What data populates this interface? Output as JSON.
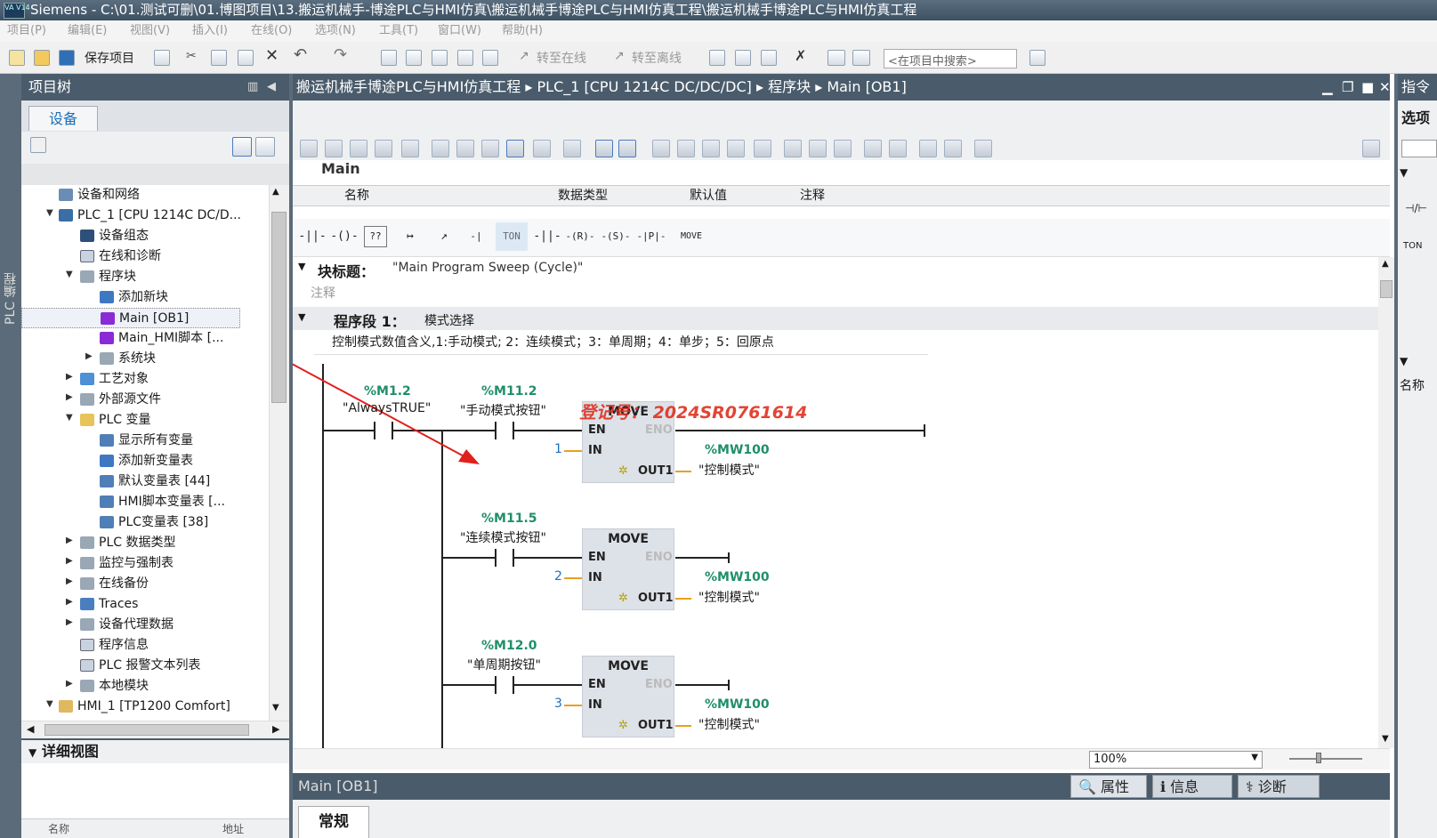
{
  "window": {
    "title": "Siemens  -  C:\\01.测试可删\\01.博图项目\\13.搬运机械手-博途PLC与HMI仿真\\搬运机械手博途PLC与HMI仿真工程\\搬运机械手博途PLC与HMI仿真工程",
    "logo_text": "VA V14"
  },
  "menu": [
    "项目(P)",
    "编辑(E)",
    "视图(V)",
    "插入(I)",
    "在线(O)",
    "选项(N)",
    "工具(T)",
    "窗口(W)",
    "帮助(H)"
  ],
  "toolbar": {
    "save_label": "保存项目",
    "go_online": "转至在线",
    "go_offline": "转至离线",
    "search_placeholder": "<在项目中搜索>"
  },
  "left_strip": {
    "label": "PLC 编程"
  },
  "project_tree": {
    "title": "项目树",
    "tab": "设备",
    "items": [
      {
        "label": "设备和网络"
      },
      {
        "label": "PLC_1 [CPU 1214C DC/D..."
      },
      {
        "label": "设备组态"
      },
      {
        "label": "在线和诊断"
      },
      {
        "label": "程序块"
      },
      {
        "label": "添加新块"
      },
      {
        "label": "Main [OB1]"
      },
      {
        "label": "Main_HMI脚本 [..."
      },
      {
        "label": "系统块"
      },
      {
        "label": "工艺对象"
      },
      {
        "label": "外部源文件"
      },
      {
        "label": "PLC 变量"
      },
      {
        "label": "显示所有变量"
      },
      {
        "label": "添加新变量表"
      },
      {
        "label": "默认变量表 [44]"
      },
      {
        "label": "HMI脚本变量表 [..."
      },
      {
        "label": "PLC变量表 [38]"
      },
      {
        "label": "PLC 数据类型"
      },
      {
        "label": "监控与强制表"
      },
      {
        "label": "在线备份"
      },
      {
        "label": "Traces"
      },
      {
        "label": "设备代理数据"
      },
      {
        "label": "程序信息"
      },
      {
        "label": "PLC 报警文本列表"
      },
      {
        "label": "本地模块"
      },
      {
        "label": "HMI_1 [TP1200 Comfort]"
      }
    ]
  },
  "detail_view": {
    "title": "详细视图",
    "col_name": "名称",
    "col_addr": "地址"
  },
  "editor": {
    "breadcrumb": [
      "搬运机械手博途PLC与HMI仿真工程",
      "PLC_1 [CPU 1214C DC/DC/DC]",
      "程序块",
      "Main [OB1]"
    ],
    "interface_title": "Main",
    "columns": [
      "名称",
      "数据类型",
      "默认值",
      "注释"
    ],
    "ladder_buttons": [
      "-||-",
      "-()-",
      "??",
      "↦",
      "↗",
      "-|↓|-",
      "TON",
      "-||-",
      "-(R)-",
      "-(S)-",
      "-|P|-",
      "MOVE"
    ],
    "block_title_label": "块标题：",
    "block_title": "\"Main Program Sweep (Cycle)\"",
    "comment_label": "注释",
    "network_label": "程序段 1：",
    "network_title": "模式选择",
    "network_comment": "控制模式数值含义,1:手动模式; 2：连续模式；3：单周期；4：单步；5：回原点",
    "watermark": "登记号：  2024SR0761614",
    "rungs": [
      {
        "contacts": [
          {
            "addr": "%M1.2",
            "sym": "\"AlwaysTRUE\""
          },
          {
            "addr": "%M11.2",
            "sym": "\"手动模式按钮\""
          }
        ],
        "move": "MOVE",
        "in": "1",
        "out_addr": "%MW100",
        "out_sym": "\"控制模式\""
      },
      {
        "contacts": [
          {
            "addr": "%M11.5",
            "sym": "\"连续模式按钮\""
          }
        ],
        "move": "MOVE",
        "in": "2",
        "out_addr": "%MW100",
        "out_sym": "\"控制模式\""
      },
      {
        "contacts": [
          {
            "addr": "%M12.0",
            "sym": "\"单周期按钮\""
          }
        ],
        "move": "MOVE",
        "in": "3",
        "out_addr": "%MW100",
        "out_sym": "\"控制模式\""
      }
    ],
    "pins": {
      "en": "EN",
      "eno": "ENO",
      "in": "IN",
      "out": "OUT1"
    },
    "zoom": "100%"
  },
  "inspector": {
    "title": "Main [OB1]",
    "tabs": [
      "属性",
      "信息",
      "诊断"
    ],
    "subtab": "常规"
  },
  "right_panel": {
    "title": "指令",
    "options": "选项",
    "item1": "⊣/⊢",
    "item2": "TON",
    "name_col": "名称"
  },
  "colors": {
    "dark_header": "#4a5c6c",
    "address": "#1f8f6a",
    "watermark": "#e0301e"
  }
}
